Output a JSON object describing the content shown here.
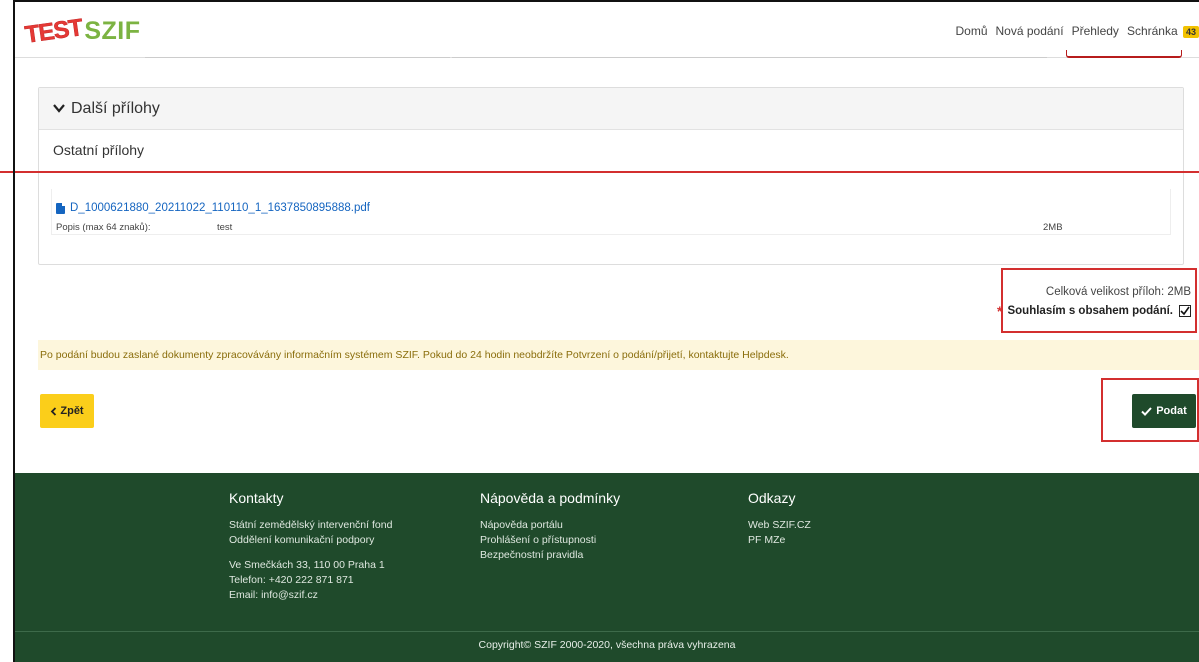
{
  "header": {
    "logo_test": "TEST",
    "logo_name": "SZIF",
    "nav": [
      "Domů",
      "Nová podání",
      "Přehledy",
      "Schránka"
    ],
    "inbox_count": "43"
  },
  "attachments": {
    "section_title": "Další přílohy",
    "group_title": "Ostatní přílohy",
    "file": {
      "name": "D_1000621880_20211022_110110_1_1637850895888.pdf",
      "desc_label": "Popis (max 64 znaků):",
      "desc_value": "test",
      "size": "2MB"
    }
  },
  "summary": {
    "total_size": "Celková velikost příloh: 2MB",
    "required_mark": "*",
    "consent_label": "Souhlasím s obsahem podání.",
    "consent_checked": true
  },
  "info_banner": "Po podání budou zaslané dokumenty zpracovávány informačním systémem SZIF. Pokud do 24 hodin neobdržíte Potvrzení o podání/přijetí, kontaktujte Helpdesk.",
  "actions": {
    "back_label": "Zpět",
    "submit_label": "Podat"
  },
  "footer": {
    "contacts": {
      "title": "Kontakty",
      "line1": "Státní zemědělský intervenční fond",
      "line2": "Oddělení komunikační podpory",
      "line3": "Ve Smečkách 33, 110 00 Praha 1",
      "line4": "Telefon: +420 222 871 871",
      "line5": "Email: info@szif.cz"
    },
    "help": {
      "title": "Nápověda a podmínky",
      "line1": "Nápověda portálu",
      "line2": "Prohlášení o přístupnosti",
      "line3": "Bezpečnostní pravidla"
    },
    "links": {
      "title": "Odkazy",
      "line1": "Web SZIF.CZ",
      "line2": "PF MZe"
    },
    "copyright": "Copyright© SZIF 2000-2020, všechna práva vyhrazena"
  },
  "colors": {
    "brand_green": "#1f4a2b",
    "accent_yellow": "#fbce1a",
    "annotation_red": "#d32f2f",
    "link_blue": "#1565c0"
  }
}
